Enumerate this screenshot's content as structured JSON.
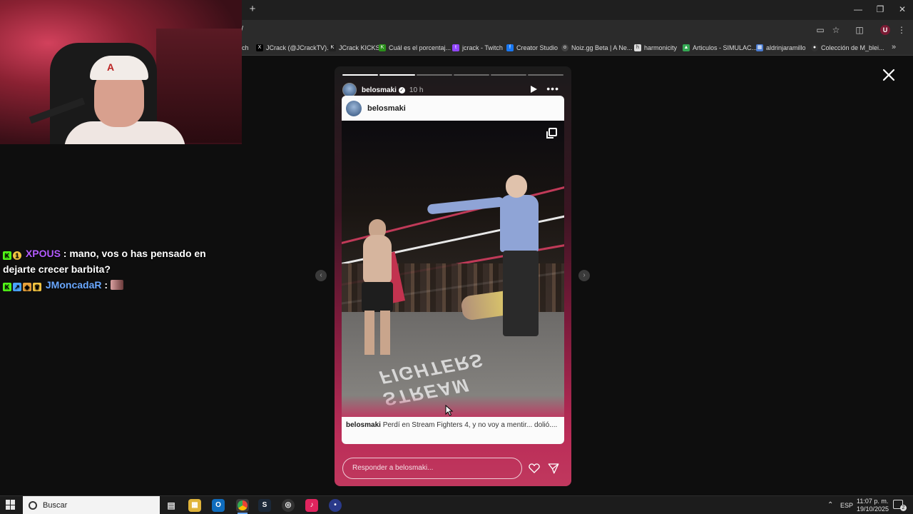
{
  "browser": {
    "url_fragment": "/",
    "bookmarks": [
      {
        "label": "ch",
        "icon": "twitch-icon",
        "color": "#9146ff"
      },
      {
        "label": "JCrack (@JCrackTV)...",
        "icon": "x-icon",
        "color": "#000000"
      },
      {
        "label": "JCrack KICKS",
        "icon": "kick-icon",
        "color": "#222222"
      },
      {
        "label": "Cuál es el porcentaj...",
        "icon": "kick-green-icon",
        "color": "#53fc18"
      },
      {
        "label": "jcrack - Twitch",
        "icon": "twitch-icon",
        "color": "#9146ff"
      },
      {
        "label": "Creator Studio",
        "icon": "facebook-icon",
        "color": "#1877f2"
      },
      {
        "label": "Noiz.gg Beta | A Ne...",
        "icon": "noiz-icon",
        "color": "#444444"
      },
      {
        "label": "harmonicity",
        "icon": "harmonicity-icon",
        "color": "#dddddd"
      },
      {
        "label": "Articulos - SIMULAC...",
        "icon": "drive-icon",
        "color": "#34a853"
      },
      {
        "label": "aldrinjaramillo",
        "icon": "doc-icon",
        "color": "#4a7bd0"
      },
      {
        "label": "Colección de M_blei...",
        "icon": "collection-icon",
        "color": "#333333"
      }
    ]
  },
  "chat": {
    "messages": [
      {
        "user": "XPOUS",
        "separator": ":",
        "text": "mano, vos o has pensado en dejarte crecer barbita?"
      },
      {
        "user": "JMoncadaR",
        "separator": ":",
        "text": ""
      }
    ]
  },
  "story": {
    "progress_total": 6,
    "progress_done": 2,
    "username": "belosmaki",
    "time_ago": "10 h",
    "post_username": "belosmaki",
    "photo_floor_text": "STREAM FIGHTERS",
    "caption_user": "belosmaki",
    "caption_text": "Perdí en Stream Fighters 4, y no voy a mentir... dolió....",
    "reply_placeholder": "Responder a belosmaki..."
  },
  "taskbar": {
    "search_label": "Buscar",
    "language": "ESP",
    "time": "11:07 p. m.",
    "date": "19/10/2025",
    "notification_count": "2"
  }
}
